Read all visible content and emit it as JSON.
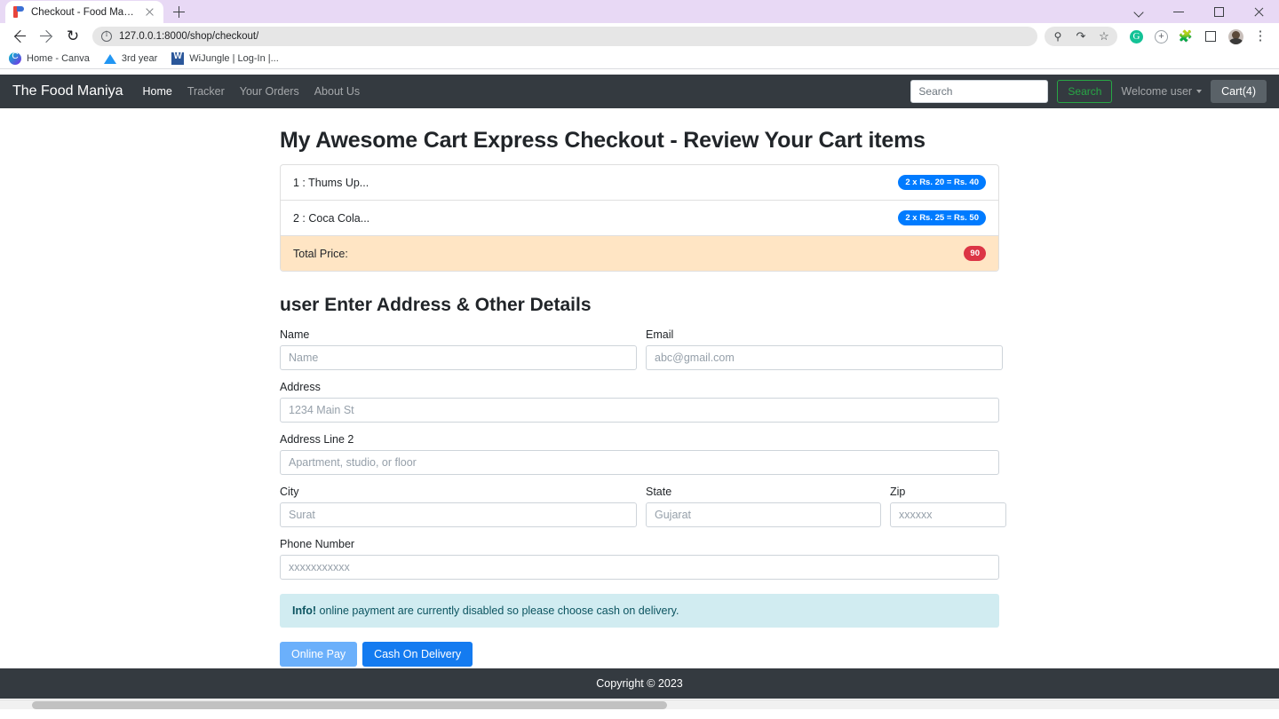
{
  "browser": {
    "tab": {
      "title": "Checkout - Food Maniya",
      "favicon": "food-maniya-favicon",
      "close_icon": "close-icon"
    },
    "new_tab_label": "+",
    "window_controls": [
      "chevron-down-icon",
      "minimize-icon",
      "maximize-icon",
      "close-icon"
    ],
    "nav": {
      "back": "back-icon",
      "forward": "forward-icon",
      "reload": "↻"
    },
    "omnibox": {
      "site_info_icon": "info-icon",
      "url": "127.0.0.1:8000/shop/checkout/"
    },
    "toolbar_icons": [
      "password-key-icon",
      "share-icon",
      "bookmark-star-icon",
      "grammarly-icon",
      "add-extension-icon",
      "extensions-puzzle-icon",
      "sidepanel-icon",
      "profile-avatar-icon",
      "chrome-menu-icon"
    ],
    "bookmarks": [
      {
        "label": "Home - Canva",
        "icon": "canva-icon"
      },
      {
        "label": "3rd year",
        "icon": "google-drive-icon"
      },
      {
        "label": "WiJungle | Log-In |...",
        "icon": "word-icon"
      }
    ]
  },
  "site": {
    "brand": "The Food Maniya",
    "nav_links": [
      {
        "label": "Home",
        "active": true
      },
      {
        "label": "Tracker",
        "active": false
      },
      {
        "label": "Your Orders",
        "active": false
      },
      {
        "label": "About Us",
        "active": false
      }
    ],
    "search": {
      "placeholder": "Search",
      "value": "",
      "button": "Search"
    },
    "account": "Welcome user",
    "cart_button": "Cart(4)",
    "footer": "Copyright © 2023"
  },
  "checkout": {
    "title": "My Awesome Cart Express Checkout - Review Your Cart items",
    "items": [
      {
        "name": "1 : Thums Up...",
        "badge": "2 x Rs. 20 = Rs. 40"
      },
      {
        "name": "2 : Coca Cola...",
        "badge": "2 x Rs. 25 = Rs. 50"
      }
    ],
    "total_label": "Total Price:",
    "total_value": "90"
  },
  "form": {
    "title": "user Enter Address & Other Details",
    "fields": {
      "name": {
        "label": "Name",
        "placeholder": "Name",
        "value": ""
      },
      "email": {
        "label": "Email",
        "placeholder": "abc@gmail.com",
        "value": ""
      },
      "address": {
        "label": "Address",
        "placeholder": "1234 Main St",
        "value": ""
      },
      "address2": {
        "label": "Address Line 2",
        "placeholder": "Apartment, studio, or floor",
        "value": ""
      },
      "city": {
        "label": "City",
        "placeholder": "Surat",
        "value": ""
      },
      "state": {
        "label": "State",
        "placeholder": "Gujarat",
        "value": ""
      },
      "zip": {
        "label": "Zip",
        "placeholder": "xxxxxx",
        "value": ""
      },
      "phone": {
        "label": "Phone Number",
        "placeholder": "xxxxxxxxxxx",
        "value": ""
      }
    },
    "alert": {
      "strong": "Info!",
      "text": " online payment are currently disabled so please choose cash on delivery."
    },
    "buttons": {
      "online_pay": "Online Pay",
      "cod": "Cash On Delivery"
    }
  },
  "colors": {
    "navbar": "#343a40",
    "badge_blue": "#007bff",
    "badge_red": "#dc3545",
    "total_row": "#ffe5c4",
    "alert_info_bg": "#d1ecf1",
    "primary_button": "#147bf0",
    "search_green": "#28a745"
  }
}
